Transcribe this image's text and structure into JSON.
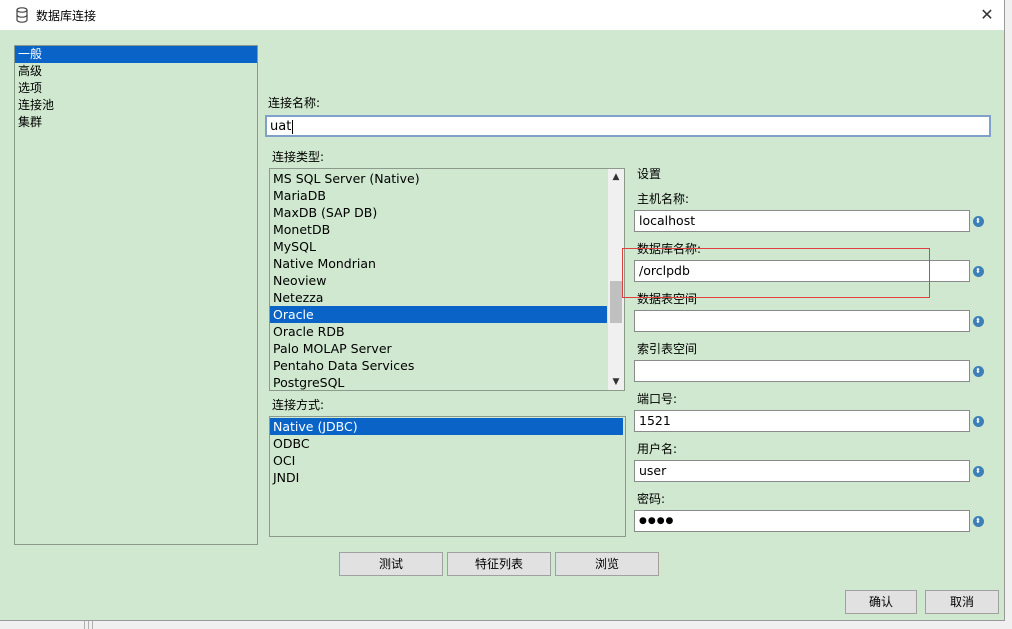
{
  "window": {
    "title": "数据库连接",
    "close": "✕"
  },
  "nav": {
    "items": [
      "一般",
      "高级",
      "选项",
      "连接池",
      "集群"
    ],
    "selected": 0
  },
  "connection_name": {
    "label": "连接名称:",
    "value": "uat"
  },
  "connection_type": {
    "label": "连接类型:",
    "items": [
      "MS SQL Server (Native)",
      "MariaDB",
      "MaxDB (SAP DB)",
      "MonetDB",
      "MySQL",
      "Native Mondrian",
      "Neoview",
      "Netezza",
      "Oracle",
      "Oracle RDB",
      "Palo MOLAP Server",
      "Pentaho Data Services",
      "PostgreSQL"
    ],
    "selected": "Oracle"
  },
  "access": {
    "label": "连接方式:",
    "items": [
      "Native (JDBC)",
      "ODBC",
      "OCI",
      "JNDI"
    ],
    "selected": "Native (JDBC)"
  },
  "settings": {
    "title": "设置",
    "host_label": "主机名称:",
    "host_value": "localhost",
    "db_label": "数据库名称:",
    "db_value": "/orclpdb",
    "data_ts_label": "数据表空间",
    "data_ts_value": "",
    "index_ts_label": "索引表空间",
    "index_ts_value": "",
    "port_label": "端口号:",
    "port_value": "1521",
    "user_label": "用户名:",
    "user_value": "user",
    "password_label": "密码:",
    "password_value": "●●●●"
  },
  "buttons": {
    "test": "测试",
    "features": "特征列表",
    "explore": "浏览",
    "ok": "确认",
    "cancel": "取消"
  },
  "scroll": {
    "up": "▲",
    "down": "▼"
  },
  "spin_glyph": "⬍",
  "colors": {
    "dialog_bg": "#cfe8cf",
    "selection": "#0a64c8",
    "highlight_box": "#e04040"
  }
}
